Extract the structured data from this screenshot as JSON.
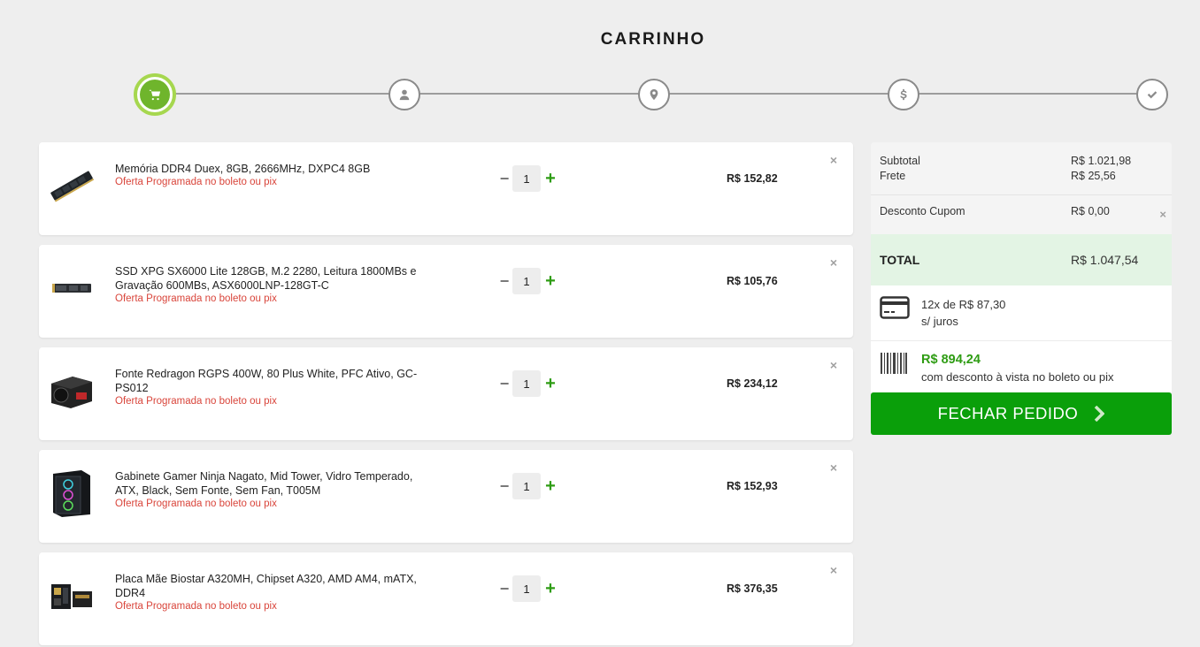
{
  "page": {
    "title": "CARRINHO"
  },
  "stepper": {
    "steps": [
      {
        "icon": "cart-icon",
        "active": true
      },
      {
        "icon": "user-icon",
        "active": false
      },
      {
        "icon": "map-pin-icon",
        "active": false
      },
      {
        "icon": "dollar-icon",
        "active": false
      },
      {
        "icon": "check-icon",
        "active": false
      }
    ]
  },
  "cart": {
    "items": [
      {
        "name": "Memória DDR4 Duex, 8GB, 2666MHz, DXPC4 8GB",
        "offer": "Oferta Programada no boleto ou pix",
        "qty": "1",
        "price": "R$ 152,82",
        "remove": "×"
      },
      {
        "name": "SSD XPG SX6000 Lite 128GB, M.2 2280, Leitura 1800MBs e Gravação 600MBs, ASX6000LNP-128GT-C",
        "offer": "Oferta Programada no boleto ou pix",
        "qty": "1",
        "price": "R$ 105,76",
        "remove": "×"
      },
      {
        "name": "Fonte Redragon RGPS 400W, 80 Plus White, PFC Ativo, GC-PS012",
        "offer": "Oferta Programada no boleto ou pix",
        "qty": "1",
        "price": "R$ 234,12",
        "remove": "×"
      },
      {
        "name": "Gabinete Gamer Ninja Nagato, Mid Tower, Vidro Temperado, ATX, Black, Sem Fonte, Sem Fan, T005M",
        "offer": "Oferta Programada no boleto ou pix",
        "qty": "1",
        "price": "R$ 152,93",
        "remove": "×"
      },
      {
        "name": "Placa Mãe Biostar A320MH, Chipset A320, AMD AM4, mATX, DDR4",
        "offer": "Oferta Programada no boleto ou pix",
        "qty": "1",
        "price": "R$ 376,35",
        "remove": "×"
      }
    ],
    "minus": "−",
    "plus": "+"
  },
  "summary": {
    "subtotal_label": "Subtotal",
    "subtotal_value": "R$ 1.021,98",
    "frete_label": "Frete",
    "frete_value": "R$ 25,56",
    "coupon_label": "Desconto Cupom",
    "coupon_value": "R$ 0,00",
    "coupon_remove": "×",
    "total_label": "TOTAL",
    "total_value": "R$ 1.047,54",
    "card_line1": "12x de R$ 87,30",
    "card_line2": "s/ juros",
    "boleto_price": "R$ 894,24",
    "boleto_desc": "com desconto à vista no boleto ou pix",
    "checkout_label": "FECHAR PEDIDO"
  },
  "colors": {
    "accent_green": "#0a9f0a",
    "offer_red": "#d9453b",
    "step_active": "#6fb52c"
  }
}
